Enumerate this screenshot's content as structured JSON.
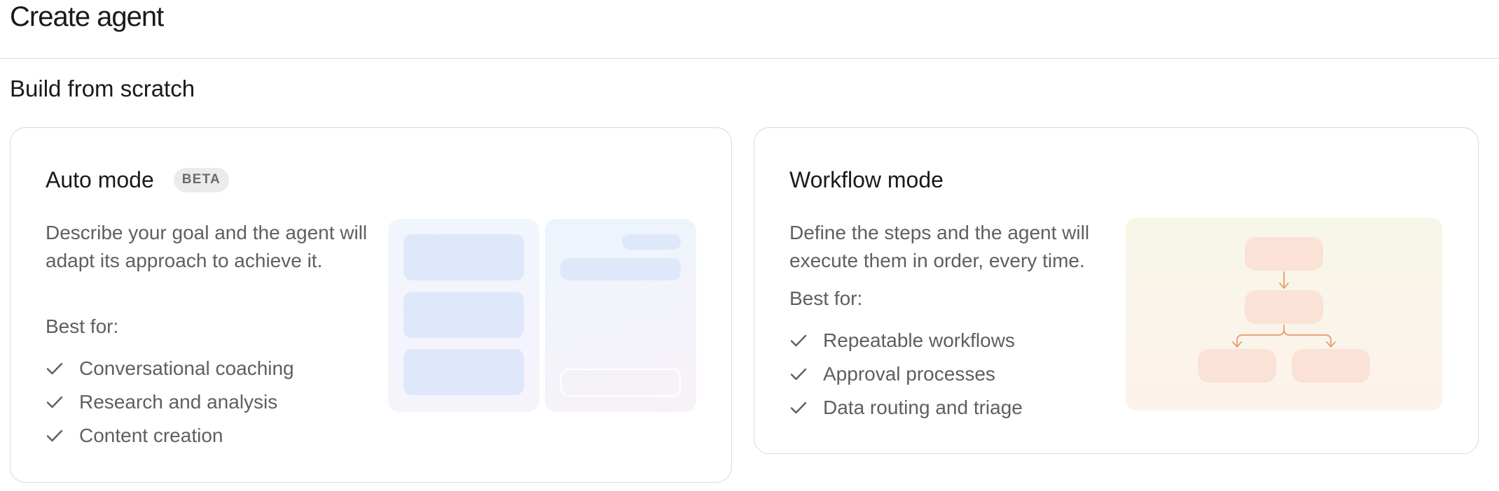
{
  "page": {
    "title": "Create agent",
    "section_title": "Build from scratch"
  },
  "cards": [
    {
      "title": "Auto mode",
      "badge": "BETA",
      "description": "Describe your goal and the agent will adapt its approach to achieve it.",
      "best_for_label": "Best for:",
      "items": [
        "Conversational coaching",
        "Research and analysis",
        "Content creation"
      ]
    },
    {
      "title": "Workflow mode",
      "badge": "",
      "description": "Define the steps and the agent will execute them in order, every time.",
      "best_for_label": "Best for:",
      "items": [
        "Repeatable workflows",
        "Approval processes",
        "Data routing and triage"
      ]
    }
  ],
  "icons": {
    "check": "check-icon"
  },
  "colors": {
    "text_primary": "#1a1a1a",
    "text_secondary": "#5f5f5f",
    "card_border": "#d8d8d8",
    "badge_bg": "#ebebeb",
    "auto_block": "#dfe8fb",
    "flow_node": "#fbe2d6",
    "flow_arrow": "#e8a57a"
  }
}
